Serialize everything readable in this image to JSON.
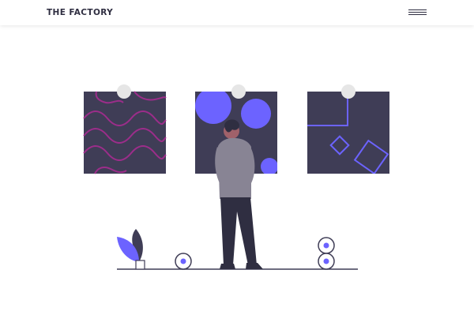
{
  "header": {
    "brand": "THE FACTORY",
    "menu_icon": "hamburger-menu-icon"
  },
  "hero": {
    "illustration": "person-viewing-art-gallery",
    "colors": {
      "dark": "#3f3d56",
      "accent": "#6c63ff",
      "pink": "#9c2d8a",
      "shirt": "#888494",
      "pants": "#2f2e41"
    }
  }
}
